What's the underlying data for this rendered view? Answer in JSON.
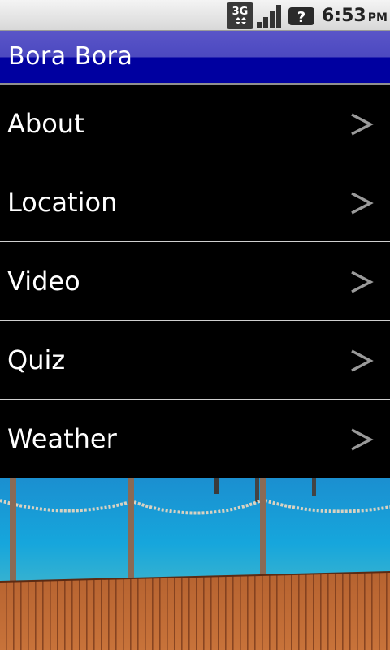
{
  "status_bar": {
    "network_type": "3G",
    "time": "6:53",
    "ampm": "PM",
    "icons": [
      "3g-data-icon",
      "signal-strength-icon",
      "help-question-icon"
    ]
  },
  "title_bar": {
    "title": "Bora Bora",
    "colors": {
      "top": "#5a55c8",
      "bottom": "#0000a0"
    }
  },
  "menu": {
    "items": [
      {
        "label": "About"
      },
      {
        "label": "Location"
      },
      {
        "label": "Video"
      },
      {
        "label": "Quiz"
      },
      {
        "label": "Weather"
      }
    ],
    "chevron_icon": "chevron-right-icon",
    "divider_color": "#d0d0d0"
  },
  "background": {
    "image": "dock-over-lagoon-photo",
    "colors": {
      "water": "#1aa0d8",
      "deck": "#b0582a"
    }
  }
}
